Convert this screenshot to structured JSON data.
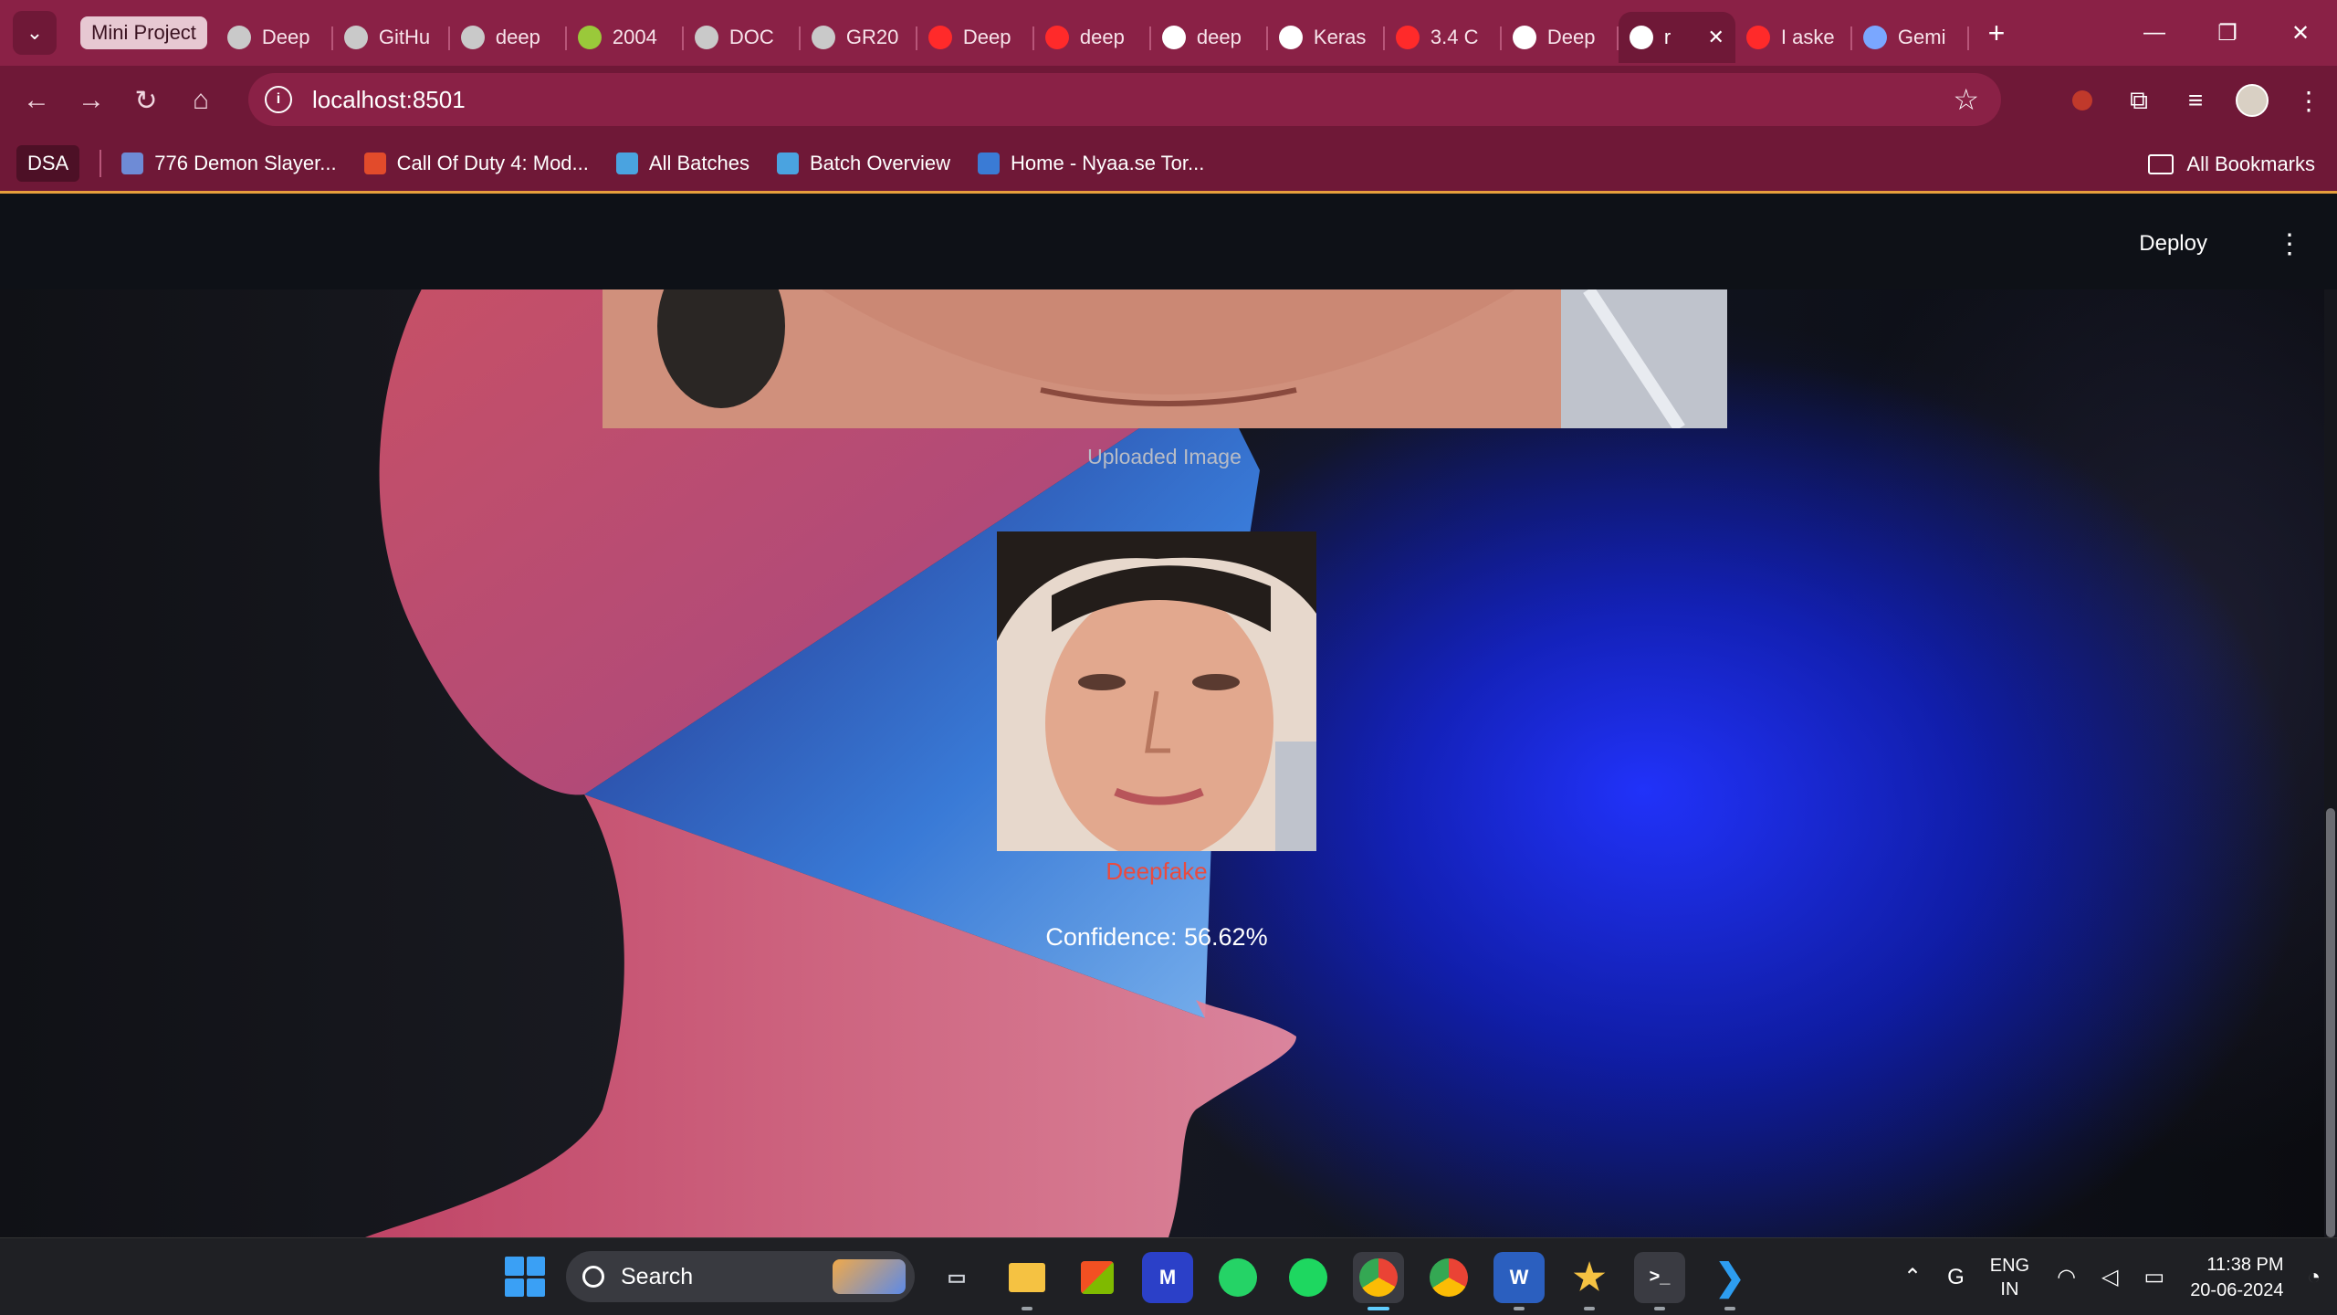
{
  "browser": {
    "tab_group_label": "Mini Project",
    "tabs": [
      {
        "title": "Deep",
        "icon": "ring-icon",
        "color": "#c9c9c9",
        "active": false
      },
      {
        "title": "GitHu",
        "icon": "github-icon",
        "color": "#c9c9c9",
        "active": false
      },
      {
        "title": "deep",
        "icon": "github-icon",
        "color": "#c9c9c9",
        "active": false
      },
      {
        "title": "2004",
        "icon": "smiley-icon",
        "color": "#9ac93a",
        "active": false
      },
      {
        "title": "DOC",
        "icon": "globe-icon",
        "color": "#c9c9c9",
        "active": false
      },
      {
        "title": "GR20",
        "icon": "globe-icon",
        "color": "#c9c9c9",
        "active": false
      },
      {
        "title": "Deep",
        "icon": "youtube-icon",
        "color": "#ff2a2a",
        "active": false
      },
      {
        "title": "deep",
        "icon": "youtube-icon",
        "color": "#ff2a2a",
        "active": false
      },
      {
        "title": "deep",
        "icon": "github-icon",
        "color": "#ffffff",
        "active": false
      },
      {
        "title": "Keras",
        "icon": "keras-icon",
        "color": "#ffffff",
        "active": false
      },
      {
        "title": "3.4 C",
        "icon": "youtube-icon",
        "color": "#ff2a2a",
        "active": false
      },
      {
        "title": "Deep",
        "icon": "openai-icon",
        "color": "#ffffff",
        "active": false
      },
      {
        "title": "r",
        "icon": "crown-icon",
        "color": "#ffffff",
        "active": true
      },
      {
        "title": "I aske",
        "icon": "youtube-icon",
        "color": "#ff2a2a",
        "active": false
      },
      {
        "title": "Gemi",
        "icon": "gemini-icon",
        "color": "#7aa7ff",
        "active": false
      }
    ],
    "url": "localhost:8501",
    "bookmarks_folder": "DSA",
    "bookmarks": [
      {
        "label": "776 Demon Slayer...",
        "icon": "demon-slayer-icon",
        "color": "#6e8bd6"
      },
      {
        "label": "Call Of Duty 4: Mod...",
        "icon": "flame-icon",
        "color": "#e24b2b"
      },
      {
        "label": "All Batches",
        "icon": "diamond-icon",
        "color": "#4aa3e0"
      },
      {
        "label": "Batch Overview",
        "icon": "diamond-icon",
        "color": "#4aa3e0"
      },
      {
        "label": "Home - Nyaa.se Tor...",
        "icon": "nyaa-icon",
        "color": "#3a7bd5"
      }
    ],
    "all_bookmarks_label": "All Bookmarks"
  },
  "app": {
    "deploy_label": "Deploy",
    "uploaded_caption": "Uploaded Image",
    "prediction_label": "Deepfake",
    "confidence_text": "Confidence: 56.62%",
    "prediction_color": "#ea4b3f"
  },
  "taskbar": {
    "search_placeholder": "Search",
    "apps": [
      "task-view",
      "file-explorer",
      "microsoft-store",
      "editor",
      "whatsapp",
      "spotify",
      "chrome",
      "chrome",
      "word",
      "starred-app",
      "terminal",
      "vscode"
    ],
    "language_line1": "ENG",
    "language_line2": "IN",
    "time": "11:38 PM",
    "date": "20-06-2024"
  }
}
